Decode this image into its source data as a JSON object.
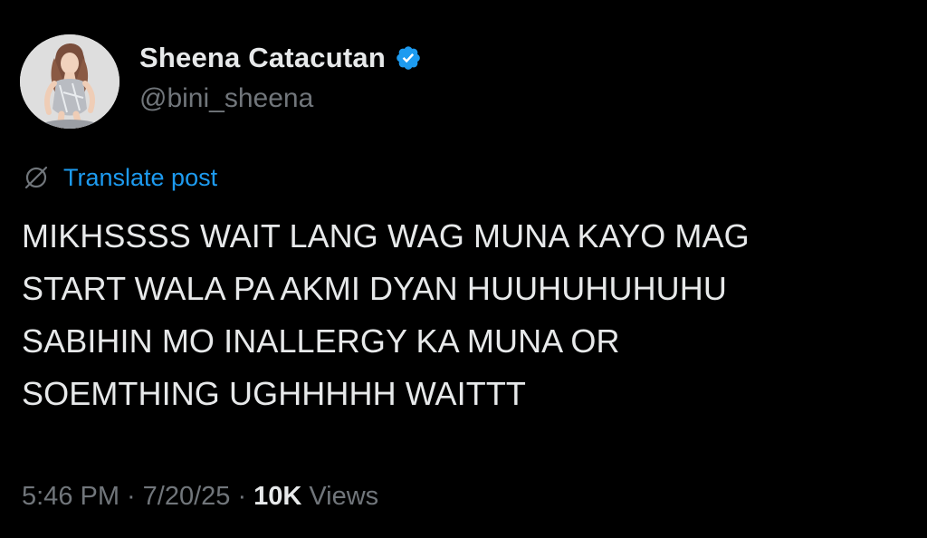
{
  "author": {
    "display_name": "Sheena Catacutan",
    "handle": "@bini_sheena",
    "verified": true,
    "verified_icon": "verified-badge-icon",
    "verified_color": "#1d9bf0"
  },
  "translate": {
    "icon": "globe-icon",
    "label": "Translate post",
    "color": "#1d9bf0"
  },
  "post": {
    "text": "MIKHSSSS WAIT LANG WAG MUNA KAYO MAG\nSTART WALA PA AKMI DYAN HUUHUHUHUHU\nSABIHIN MO INALLERGY KA MUNA OR\nSOEMTHING UGHHHHH WAITTT"
  },
  "meta": {
    "time": "5:46 PM",
    "separator": "·",
    "date": "7/20/25",
    "views_count": "10K",
    "views_label": "Views"
  },
  "colors": {
    "background": "#000000",
    "primary_text": "#e7e9ea",
    "secondary_text": "#71767b",
    "accent": "#1d9bf0"
  }
}
